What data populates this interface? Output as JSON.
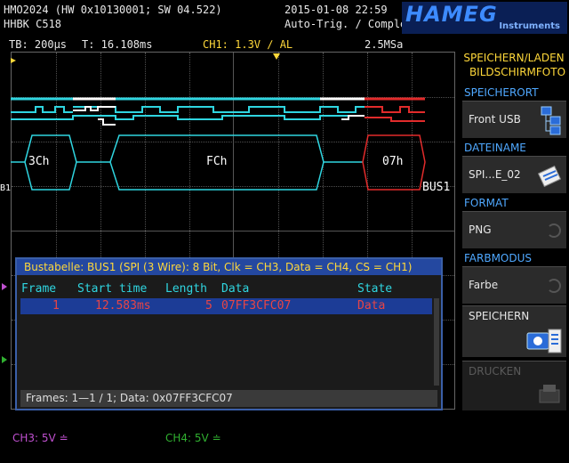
{
  "header": {
    "model": "HMO2024 (HW 0x10130001; SW 04.522)",
    "device": "HHBK C518",
    "datetime": "2015-01-08 22:59",
    "trigger_status": "Auto-Trig. / Complete"
  },
  "logo": {
    "brand": "HAMEG",
    "sub": "Instruments"
  },
  "info": {
    "timebase": "TB: 200µs",
    "time": "T: 16.108ms",
    "channel": "CH1: 1.3V ∕ AL",
    "samplerate": "2.5MSa"
  },
  "bus": {
    "left_marker": "B1",
    "right_label": "BUS1",
    "frames": [
      "3Ch",
      "FCh",
      "07h"
    ]
  },
  "table": {
    "title": "Bustabelle: BUS1 (SPI (3 Wire): 8 Bit, Clk = CH3, Data = CH4, CS = CH1)",
    "headers": {
      "frame": "Frame",
      "start": "Start time",
      "length": "Length",
      "data": "Data",
      "state": "State"
    },
    "rows": [
      {
        "frame": "1",
        "start": "12.583ms",
        "length": "5",
        "data": "07FF3CFC07",
        "state": "Data"
      }
    ],
    "footer": "Frames: 1—1 / 1; Data: 0x07FF3CFC07"
  },
  "menu": {
    "title_line1": "SPEICHERN/LADEN",
    "title_line2": "BILDSCHIRMFOTO",
    "location_label": "SPEICHERORT",
    "location_value": "Front USB",
    "filename_label": "DATEINAME",
    "filename_value": "SPI...E_02",
    "format_label": "FORMAT",
    "format_value": "PNG",
    "color_label": "FARBMODUS",
    "color_value": "Farbe",
    "save_label": "SPEICHERN",
    "print_label": "DRUCKEN"
  },
  "bottom": {
    "ch3": "CH3: 5V ≐",
    "ch4": "CH4: 5V ≐"
  },
  "colors": {
    "cyan": "#2fd5e0",
    "white": "#ffffff",
    "red": "#e22b2b",
    "menu_blue": "#4fa8ff",
    "yellow": "#ffd83a",
    "ch3": "#c050d0",
    "ch4": "#30b030"
  }
}
